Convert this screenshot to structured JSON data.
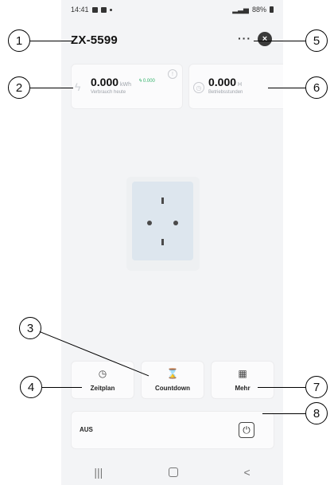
{
  "status_bar": {
    "time": "14:41",
    "battery": "88%"
  },
  "device": {
    "title": "ZX-5599",
    "more_label": "···",
    "close_label": "×"
  },
  "metrics": {
    "energy": {
      "value": "0.000",
      "unit": "kWh",
      "small_value": "0.000",
      "label": "Verbrauch heute",
      "info_icon": "!"
    },
    "hours": {
      "value": "0.000",
      "unit": "H",
      "label": "Betriebsstunden"
    }
  },
  "actions": [
    {
      "label": "Zeitplan",
      "icon": "clock-icon"
    },
    {
      "label": "Countdown",
      "icon": "hourglass-icon"
    },
    {
      "label": "Mehr",
      "icon": "grid-icon"
    }
  ],
  "power": {
    "label": "AUS"
  },
  "callouts": [
    "1",
    "2",
    "3",
    "4",
    "5",
    "6",
    "7",
    "8"
  ]
}
